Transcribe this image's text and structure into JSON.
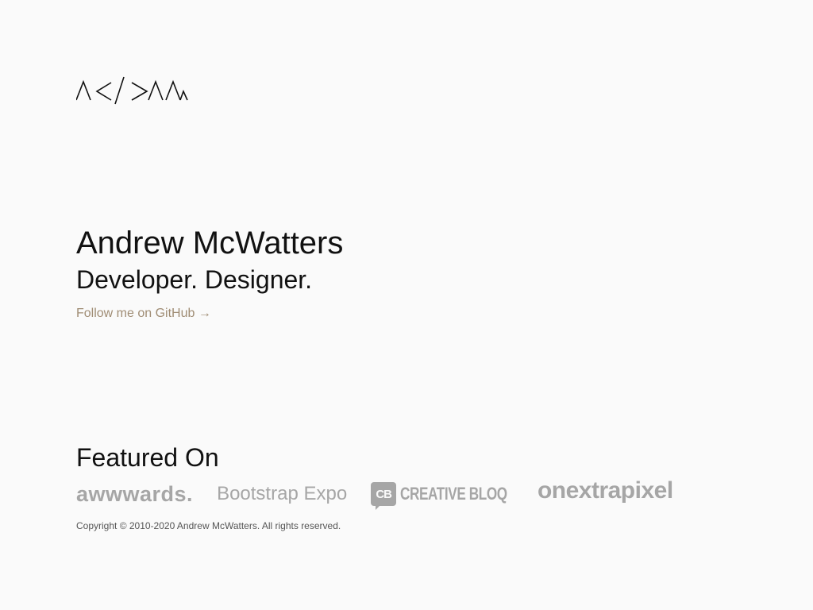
{
  "logo": {
    "alt": "ACDM logo"
  },
  "hero": {
    "name": "Andrew McWatters",
    "tagline": "Developer. Designer.",
    "github_link": "Follow me on GitHub →"
  },
  "featured": {
    "title": "Featured On",
    "logos": [
      {
        "label": "awwwards.",
        "icon": "awwwards-logo"
      },
      {
        "label": "Bootstrap Expo",
        "icon": "bootstrap-expo-logo"
      },
      {
        "badge": "CB",
        "label": "CREATIVE BLOQ",
        "icon": "creative-bloq-logo"
      },
      {
        "label": "onextrapixel",
        "icon": "onextrapixel-logo"
      }
    ]
  },
  "footer": {
    "copyright": "Copyright © 2010-2020 Andrew McWatters. All rights reserved."
  },
  "colors": {
    "background": "#fafafa",
    "text": "#111111",
    "link": "#a08d75",
    "logo_gray": "#a6a6a6",
    "muted": "#555555"
  }
}
